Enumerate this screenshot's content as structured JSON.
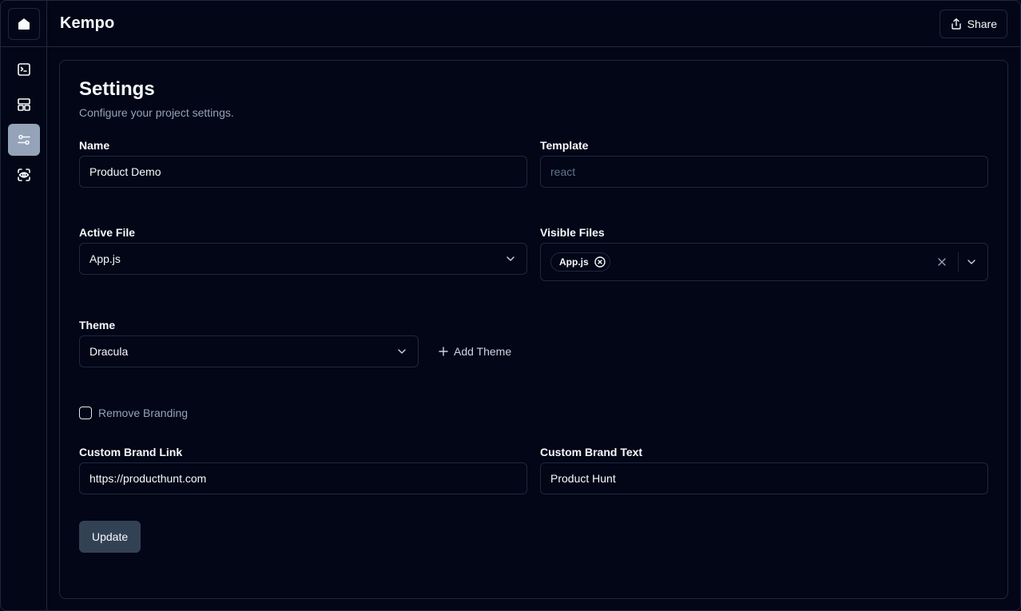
{
  "app": {
    "brand": "Kempo"
  },
  "header": {
    "share_label": "Share"
  },
  "rail": {
    "items": [
      {
        "icon": "terminal-icon"
      },
      {
        "icon": "layout-icon"
      },
      {
        "icon": "sliders-icon",
        "active": true
      },
      {
        "icon": "eye-icon"
      }
    ]
  },
  "settings": {
    "title": "Settings",
    "subtitle": "Configure your project settings.",
    "name": {
      "label": "Name",
      "value": "Product Demo"
    },
    "template": {
      "label": "Template",
      "value": "react"
    },
    "active_file": {
      "label": "Active File",
      "value": "App.js"
    },
    "visible_files": {
      "label": "Visible Files",
      "chips": [
        "App.js"
      ]
    },
    "theme": {
      "label": "Theme",
      "value": "Dracula",
      "add_label": "Add Theme"
    },
    "remove_branding": {
      "label": "Remove Branding",
      "checked": false
    },
    "brand_link": {
      "label": "Custom Brand Link",
      "value": "https://producthunt.com"
    },
    "brand_text": {
      "label": "Custom Brand Text",
      "value": "Product Hunt"
    },
    "submit_label": "Update"
  },
  "colors": {
    "background": "#020617",
    "border": "#1e293b",
    "muted_text": "#94a3b8",
    "active_nav": "#94a3b8",
    "button": "#334155"
  }
}
